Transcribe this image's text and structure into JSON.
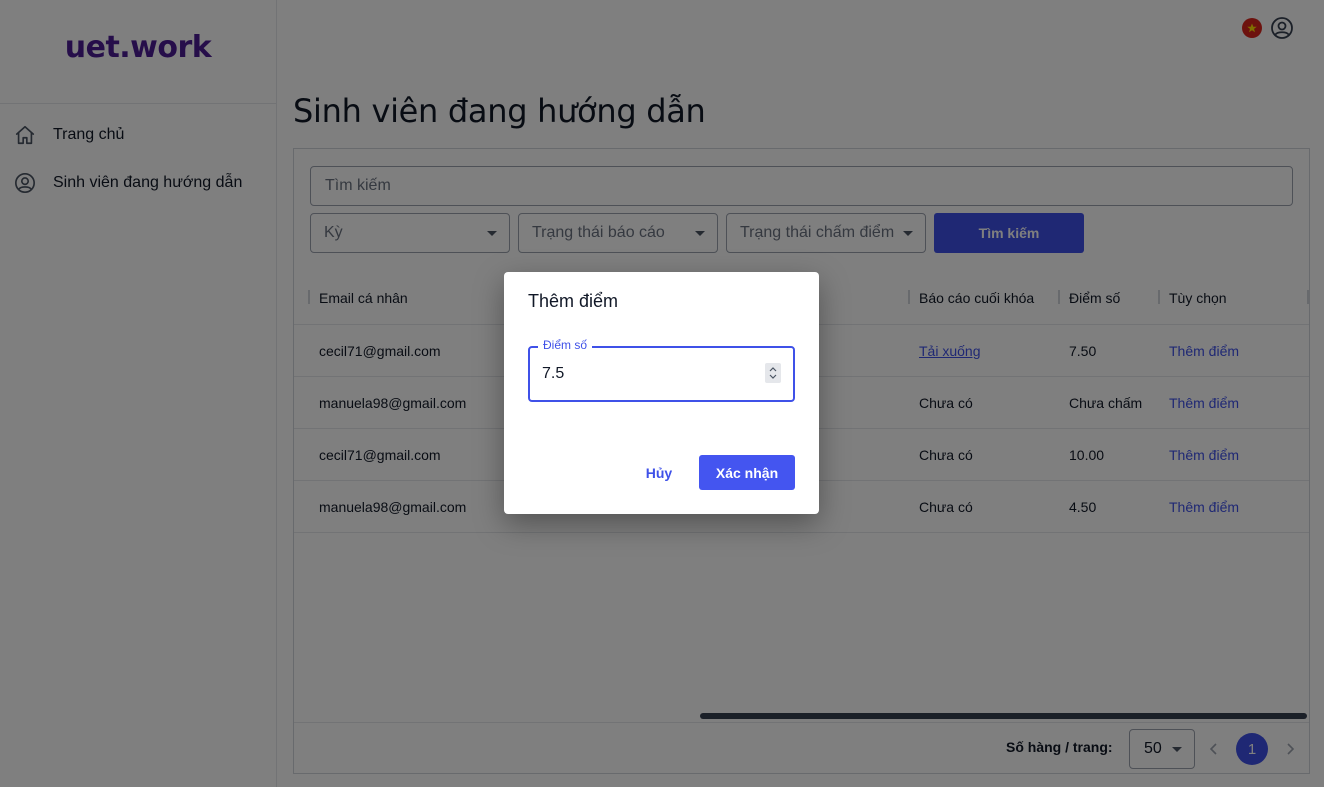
{
  "app": {
    "logo": "uet.work",
    "colors": {
      "brand": "#4c1d95",
      "primary": "#3f51e8",
      "flag": "#da251d"
    }
  },
  "sidebar": {
    "items": [
      {
        "label": "Trang chủ",
        "icon": "home-icon"
      },
      {
        "label": "Sinh viên đang hướng dẫn",
        "icon": "user-circle-icon"
      }
    ]
  },
  "header": {
    "language_icon": "vietnam-flag-icon",
    "account_icon": "user-circle-icon"
  },
  "page": {
    "title": "Sinh viên đang hướng dẫn"
  },
  "filters": {
    "search_placeholder": "Tìm kiếm",
    "term_placeholder": "Kỳ",
    "report_status_placeholder": "Trạng thái báo cáo",
    "grading_status_placeholder": "Trạng thái chấm điểm",
    "search_button": "Tìm kiếm"
  },
  "table": {
    "columns": {
      "email": "Email cá nhân",
      "final_report": "Báo cáo cuối khóa",
      "score": "Điểm số",
      "options": "Tùy chọn"
    },
    "rows": [
      {
        "email": "cecil71@gmail.com",
        "report": "Tải xuống",
        "score": "7.50",
        "action": "Thêm điểm"
      },
      {
        "email": "manuela98@gmail.com",
        "report": "Chưa có",
        "score": "Chưa chấm",
        "action": "Thêm điểm"
      },
      {
        "email": "cecil71@gmail.com",
        "report": "Chưa có",
        "score": "10.00",
        "action": "Thêm điểm"
      },
      {
        "email": "manuela98@gmail.com",
        "report": "Chưa có",
        "score": "4.50",
        "action": "Thêm điểm"
      }
    ],
    "pagination": {
      "rows_per_page_label": "Số hàng / trang:",
      "rows_per_page": "50",
      "current_page": "1"
    }
  },
  "dialog": {
    "title": "Thêm điểm",
    "field_label": "Điểm số",
    "field_value": "7.5",
    "cancel": "Hủy",
    "confirm": "Xác nhận"
  }
}
